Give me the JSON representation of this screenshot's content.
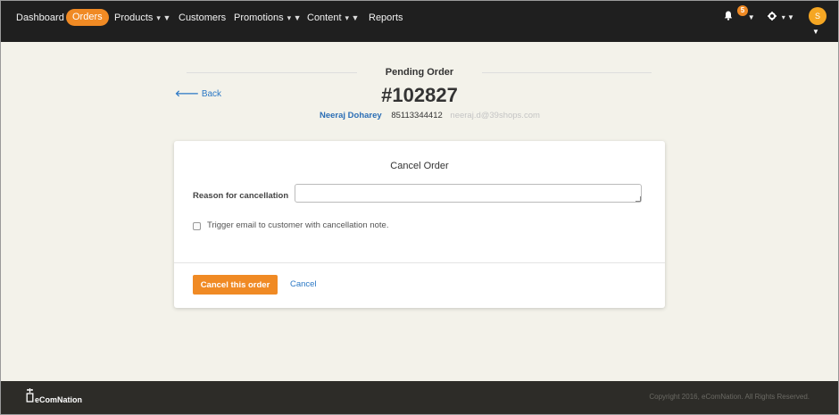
{
  "nav": {
    "items": [
      {
        "label": "Dashboard",
        "has_caret": false
      },
      {
        "label": "Orders",
        "has_caret": false,
        "active": true
      },
      {
        "label": "Products",
        "has_caret": true
      },
      {
        "label": "Customers",
        "has_caret": false
      },
      {
        "label": "Promotions",
        "has_caret": true
      },
      {
        "label": "Content",
        "has_caret": true
      },
      {
        "label": "Reports",
        "has_caret": false
      }
    ],
    "caret": "▾ ▼",
    "notification_count": "5",
    "notification_icon": "bell-icon",
    "settings_icon": "gear-icon",
    "avatar_initial": "S",
    "accent_color": "#f08a24"
  },
  "page": {
    "title": "Pending Order",
    "back_label": "Back",
    "order_number": "#102827",
    "customer": {
      "name": "Neeraj Doharey",
      "phone": "85113344412",
      "email": "neeraj.d@39shops.com"
    }
  },
  "cancel_form": {
    "title": "Cancel Order",
    "reason_label": "Reason for cancellation",
    "reason_value": "",
    "email_checkbox_label": "Trigger email to customer with cancellation note.",
    "email_checkbox_checked": false,
    "submit_label": "Cancel this order",
    "cancel_label": "Cancel"
  },
  "footer": {
    "brand": "eComNation",
    "copyright": "Copyright 2016, eComNation. All Rights Reserved."
  }
}
